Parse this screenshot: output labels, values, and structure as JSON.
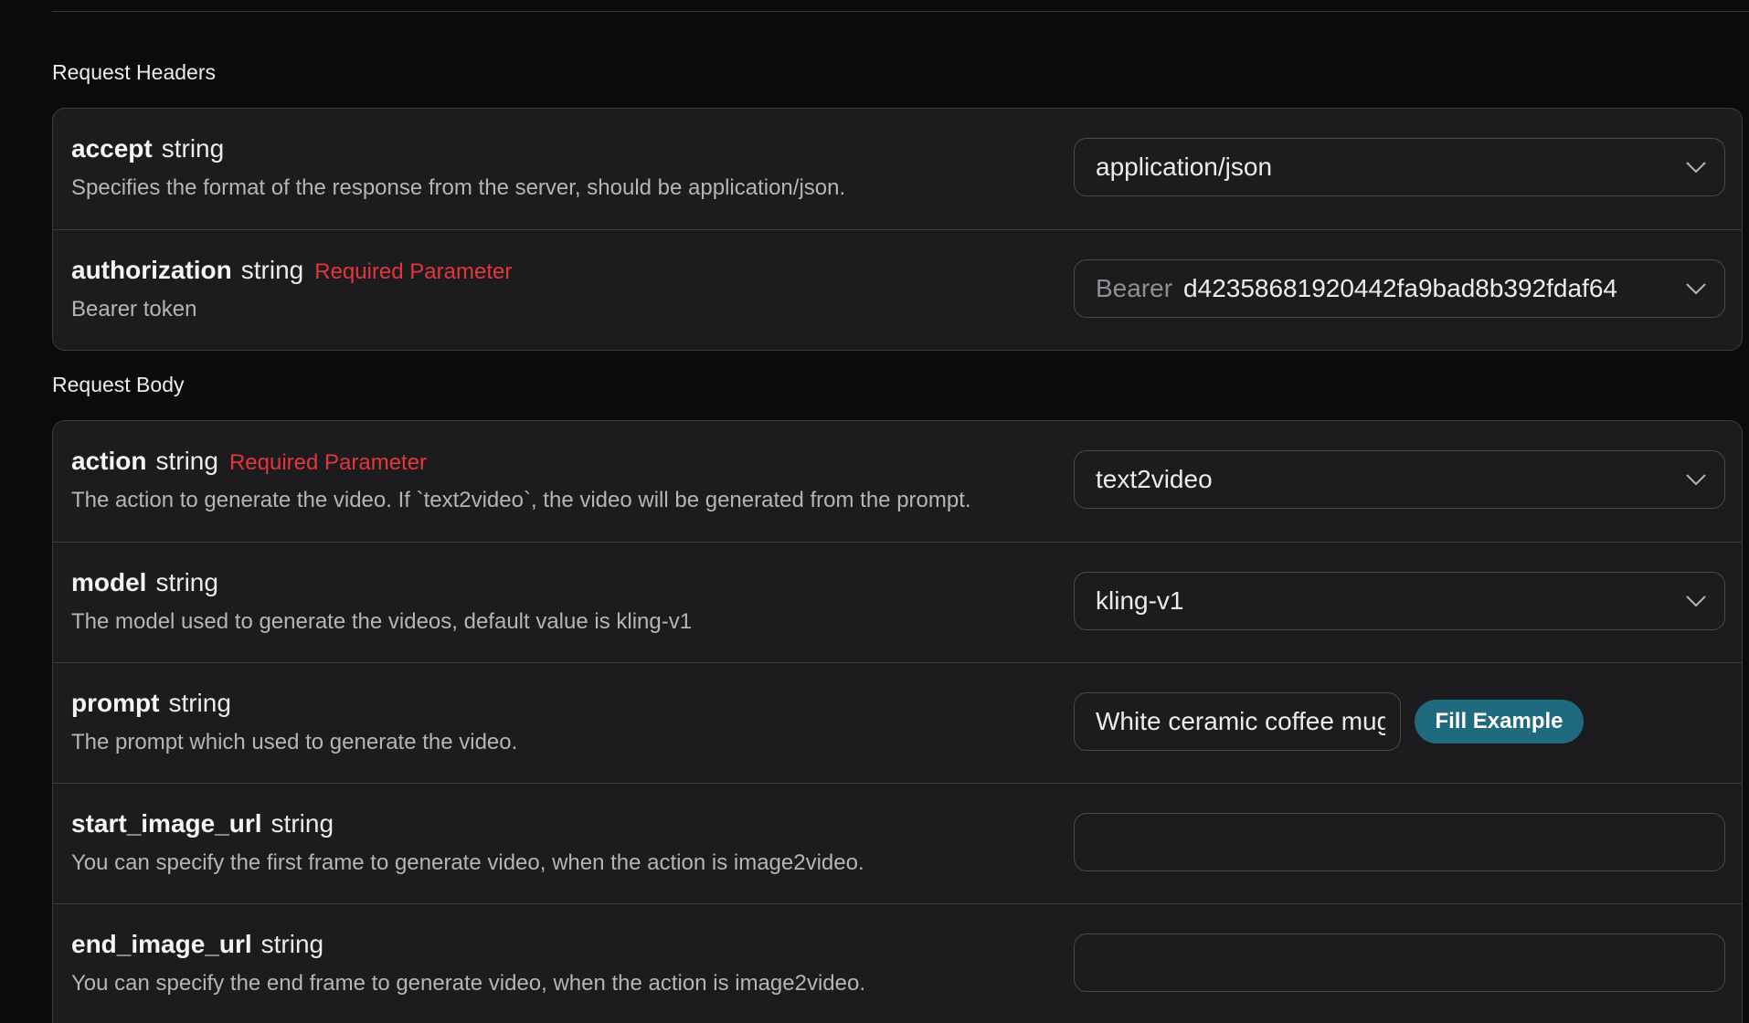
{
  "headers": {
    "title": "Request Headers",
    "params": [
      {
        "name": "accept",
        "type": "string",
        "required": "",
        "description": "Specifies the format of the response from the server, should be application/json.",
        "value": "application/json"
      },
      {
        "name": "authorization",
        "type": "string",
        "required": "Required Parameter",
        "description": "Bearer token",
        "prefix": "Bearer",
        "value": "d42358681920442fa9bad8b392fdaf64"
      }
    ]
  },
  "body": {
    "title": "Request Body",
    "params": [
      {
        "name": "action",
        "type": "string",
        "required": "Required Parameter",
        "description": "The action to generate the video. If `text2video`, the video will be generated from the prompt.",
        "value": "text2video"
      },
      {
        "name": "model",
        "type": "string",
        "required": "",
        "description": "The model used to generate the videos, default value is kling-v1",
        "value": "kling-v1"
      },
      {
        "name": "prompt",
        "type": "string",
        "required": "",
        "description": "The prompt which used to generate the video.",
        "value": "White ceramic coffee mug on glossy marble countertop",
        "button": "Fill Example"
      },
      {
        "name": "start_image_url",
        "type": "string",
        "required": "",
        "description": "You can specify the first frame to generate video, when the action is image2video.",
        "value": ""
      },
      {
        "name": "end_image_url",
        "type": "string",
        "required": "",
        "description": "You can specify the end frame to generate video, when the action is image2video.",
        "value": ""
      }
    ]
  },
  "colors": {
    "background": "#0b0b0c",
    "panel": "#1c1c1e",
    "required": "#e5353c",
    "button": "#1f6a7e"
  },
  "icons": {
    "dropdown": "chevron-down-icon"
  }
}
